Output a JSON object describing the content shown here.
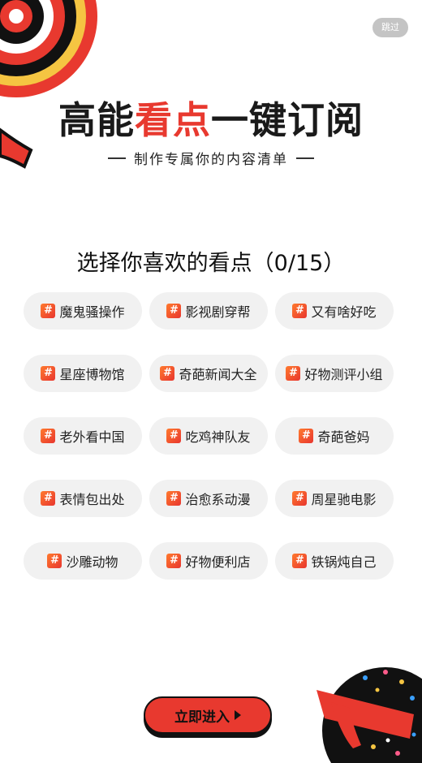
{
  "skip_label": "跳过",
  "hero": {
    "title_part1": "高能",
    "title_part2": "看点",
    "title_part3": "一键订阅",
    "subtitle": "制作专属你的内容清单"
  },
  "prompt": "选择你喜欢的看点（0/15）",
  "tag_icon": "#",
  "tags": [
    {
      "label": "魔鬼骚操作"
    },
    {
      "label": "影视剧穿帮"
    },
    {
      "label": "又有啥好吃"
    },
    {
      "label": "星座博物馆"
    },
    {
      "label": "奇葩新闻大全"
    },
    {
      "label": "好物测评小组"
    },
    {
      "label": "老外看中国"
    },
    {
      "label": "吃鸡神队友"
    },
    {
      "label": "奇葩爸妈"
    },
    {
      "label": "表情包出处"
    },
    {
      "label": "治愈系动漫"
    },
    {
      "label": "周星驰电影"
    },
    {
      "label": "沙雕动物"
    },
    {
      "label": "好物便利店"
    },
    {
      "label": "铁锅炖自己"
    }
  ],
  "enter_button": "立即进入",
  "colors": {
    "accent": "#e8392f",
    "chip_bg": "#f1f1f1",
    "text": "#1a1a1a"
  }
}
